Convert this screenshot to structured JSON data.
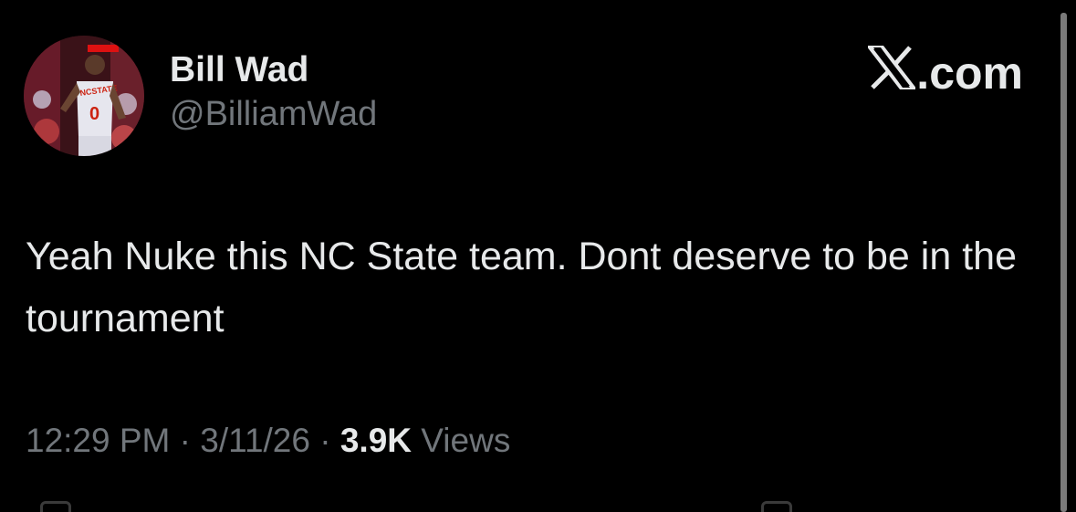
{
  "author": {
    "display_name": "Bill Wad",
    "handle": "@BilliamWad",
    "avatar_icon": "avatar-basketball-player"
  },
  "brand": {
    "label": ".com",
    "icon": "x-logo-icon"
  },
  "tweet": {
    "text": "Yeah Nuke this NC State team. Dont deserve to be in the tournament"
  },
  "meta": {
    "time": "12:29 PM",
    "separator1": " · ",
    "date": "3/11/26",
    "separator2": " · ",
    "views_count": "3.9K",
    "views_label": " Views"
  },
  "colors": {
    "background": "#000000",
    "primary_text": "#e7e9ea",
    "secondary_text": "#71767b"
  }
}
